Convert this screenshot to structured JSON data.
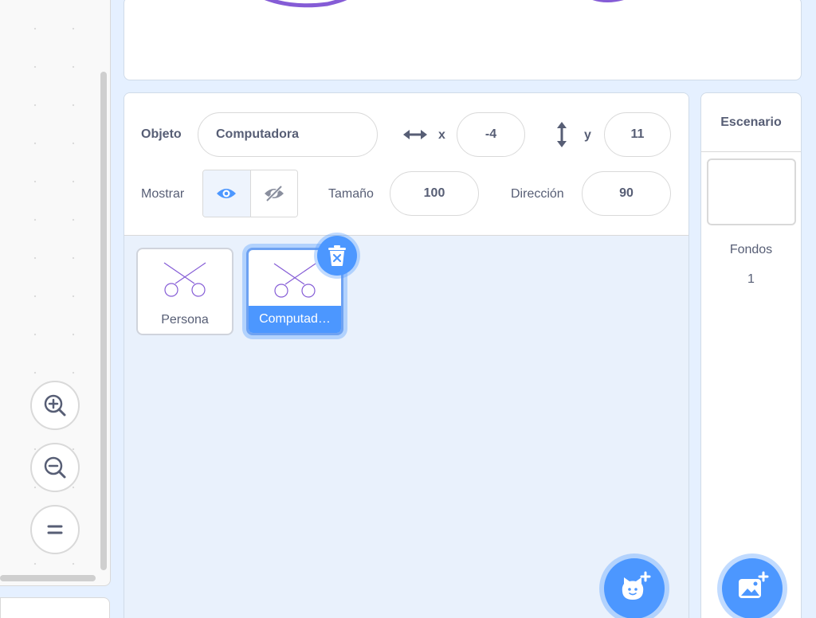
{
  "sprite_info": {
    "sprite_label": "Objeto",
    "sprite_name": "Computadora",
    "x_label": "x",
    "x_value": "-4",
    "y_label": "y",
    "y_value": "11",
    "show_label": "Mostrar",
    "size_label": "Tamaño",
    "size_value": "100",
    "direction_label": "Dirección",
    "direction_value": "90",
    "visible": true
  },
  "sprites": [
    {
      "name": "Persona",
      "selected": false
    },
    {
      "name": "Computad…",
      "selected": true
    }
  ],
  "stage_selector": {
    "title": "Escenario",
    "backdrops_label": "Fondos",
    "backdrops_count": "1"
  },
  "zoom_controls": [
    "zoom-in",
    "zoom-out",
    "zoom-reset"
  ],
  "colors": {
    "accent": "#4c97ff",
    "text": "#575e75",
    "pane_bg": "#e9f1fc",
    "stage_art": "#855cd6"
  }
}
